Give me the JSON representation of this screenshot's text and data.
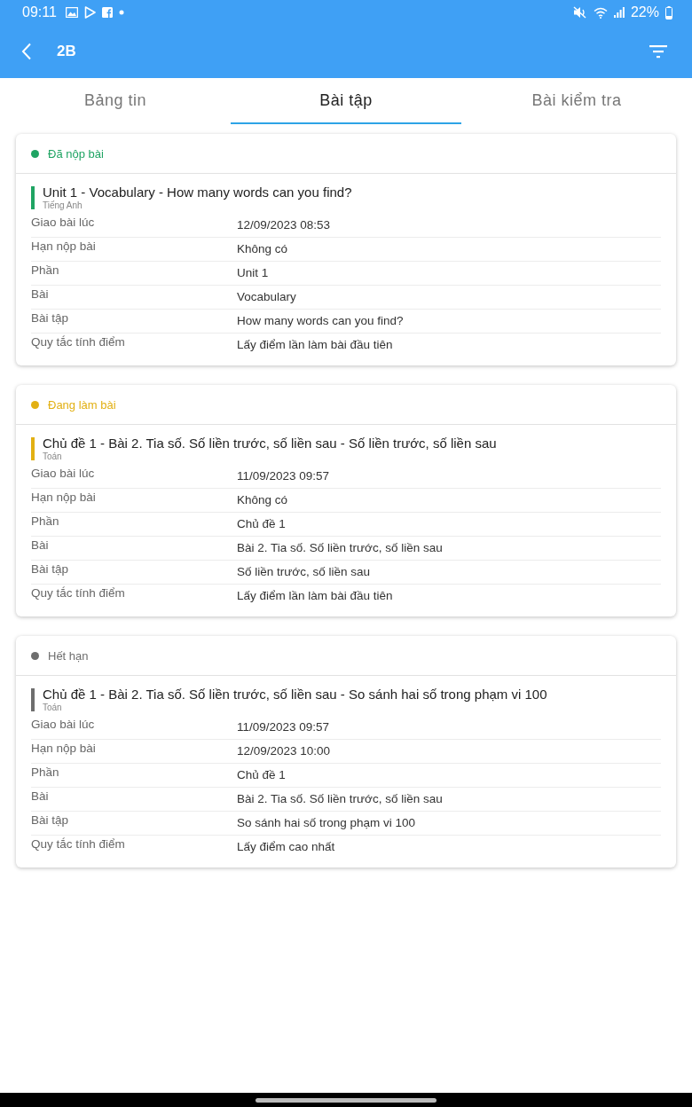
{
  "status_bar": {
    "time": "09:11",
    "battery": "22%"
  },
  "app_bar": {
    "title": "2B"
  },
  "tabs": [
    {
      "label": "Bảng tin",
      "selected": false
    },
    {
      "label": "Bài tập",
      "selected": true
    },
    {
      "label": "Bài kiểm tra",
      "selected": false
    }
  ],
  "assignments": [
    {
      "status": "Đã nộp bài",
      "color": "#1fa463",
      "title": "Unit 1 - Vocabulary - How many words can you find?",
      "subject": "Tiếng Anh",
      "fields": [
        {
          "label": "Giao bài lúc",
          "value": "12/09/2023 08:53"
        },
        {
          "label": "Hạn nộp bài",
          "value": "Không có"
        },
        {
          "label": "Phần",
          "value": "Unit 1"
        },
        {
          "label": "Bài",
          "value": "Vocabulary"
        },
        {
          "label": "Bài tập",
          "value": "How many words can you find?"
        },
        {
          "label": "Quy tắc tính điểm",
          "value": "Lấy điểm lần làm bài đầu tiên"
        }
      ]
    },
    {
      "status": "Đang làm bài",
      "color": "#e2b013",
      "title": "Chủ đề 1 - Bài 2. Tia số. Số liền trước, số liền sau - Số liền trước, số liền sau",
      "subject": "Toán",
      "fields": [
        {
          "label": "Giao bài lúc",
          "value": "11/09/2023 09:57"
        },
        {
          "label": "Hạn nộp bài",
          "value": "Không có"
        },
        {
          "label": "Phần",
          "value": "Chủ đề 1"
        },
        {
          "label": "Bài",
          "value": "Bài 2. Tia số. Số liền trước, số liền sau"
        },
        {
          "label": "Bài tập",
          "value": "Số liền trước, số liền sau"
        },
        {
          "label": "Quy tắc tính điểm",
          "value": "Lấy điểm lần làm bài đầu tiên"
        }
      ]
    },
    {
      "status": "Hết hạn",
      "color": "#6e6e6e",
      "title": "Chủ đề 1 - Bài 2. Tia số. Số liền trước, số liền sau - So sánh hai số trong phạm vi 100",
      "subject": "Toán",
      "fields": [
        {
          "label": "Giao bài lúc",
          "value": "11/09/2023 09:57"
        },
        {
          "label": "Hạn nộp bài",
          "value": "12/09/2023 10:00"
        },
        {
          "label": "Phần",
          "value": "Chủ đề 1"
        },
        {
          "label": "Bài",
          "value": "Bài 2. Tia số. Số liền trước, số liền sau"
        },
        {
          "label": "Bài tập",
          "value": "So sánh hai số trong phạm vi 100"
        },
        {
          "label": "Quy tắc tính điểm",
          "value": "Lấy điểm cao nhất"
        }
      ]
    }
  ]
}
